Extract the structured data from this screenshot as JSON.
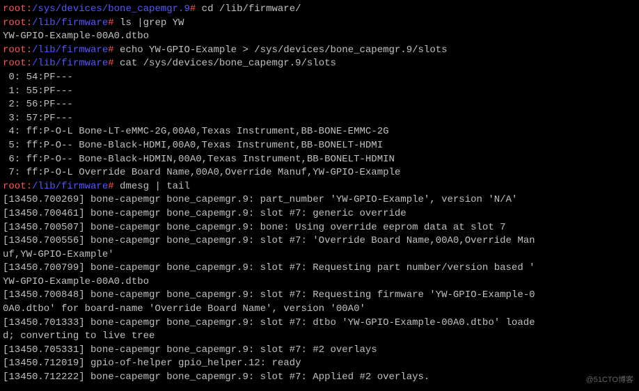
{
  "prompts": [
    {
      "user": "root",
      "sep1": ":",
      "path": "/sys/devices/bone_capemgr.9",
      "sep2": "#",
      "cmd": " cd /lib/firmware/"
    },
    {
      "user": "root",
      "sep1": ":",
      "path": "/lib/firmware",
      "sep2": "#",
      "cmd": " ls |grep YW"
    }
  ],
  "output1": "YW-GPIO-Example-00A0.dtbo",
  "prompts2": [
    {
      "user": "root",
      "sep1": ":",
      "path": "/lib/firmware",
      "sep2": "#",
      "cmd": " echo YW-GPIO-Example > /sys/devices/bone_capemgr.9/slots"
    },
    {
      "user": "root",
      "sep1": ":",
      "path": "/lib/firmware",
      "sep2": "#",
      "cmd": " cat /sys/devices/bone_capemgr.9/slots"
    }
  ],
  "slots": [
    " 0: 54:PF---",
    " 1: 55:PF---",
    " 2: 56:PF---",
    " 3: 57:PF---",
    " 4: ff:P-O-L Bone-LT-eMMC-2G,00A0,Texas Instrument,BB-BONE-EMMC-2G",
    " 5: ff:P-O-- Bone-Black-HDMI,00A0,Texas Instrument,BB-BONELT-HDMI",
    " 6: ff:P-O-- Bone-Black-HDMIN,00A0,Texas Instrument,BB-BONELT-HDMIN",
    " 7: ff:P-O-L Override Board Name,00A0,Override Manuf,YW-GPIO-Example"
  ],
  "prompt3": {
    "user": "root",
    "sep1": ":",
    "path": "/lib/firmware",
    "sep2": "#",
    "cmd": " dmesg | tail"
  },
  "dmesg": [
    "[13450.700269] bone-capemgr bone_capemgr.9: part_number 'YW-GPIO-Example', version 'N/A'",
    "[13450.700461] bone-capemgr bone_capemgr.9: slot #7: generic override",
    "[13450.700507] bone-capemgr bone_capemgr.9: bone: Using override eeprom data at slot 7",
    "[13450.700556] bone-capemgr bone_capemgr.9: slot #7: 'Override Board Name,00A0,Override Man",
    "uf,YW-GPIO-Example'",
    "[13450.700799] bone-capemgr bone_capemgr.9: slot #7: Requesting part number/version based '",
    "YW-GPIO-Example-00A0.dtbo",
    "[13450.700848] bone-capemgr bone_capemgr.9: slot #7: Requesting firmware 'YW-GPIO-Example-0",
    "0A0.dtbo' for board-name 'Override Board Name', version '00A0'",
    "[13450.701333] bone-capemgr bone_capemgr.9: slot #7: dtbo 'YW-GPIO-Example-00A0.dtbo' loade",
    "d; converting to live tree",
    "[13450.705331] bone-capemgr bone_capemgr.9: slot #7: #2 overlays",
    "[13450.712019] gpio-of-helper gpio_helper.12: ready",
    "[13450.712222] bone-capemgr bone_capemgr.9: slot #7: Applied #2 overlays."
  ],
  "watermark": "@51CTO博客"
}
